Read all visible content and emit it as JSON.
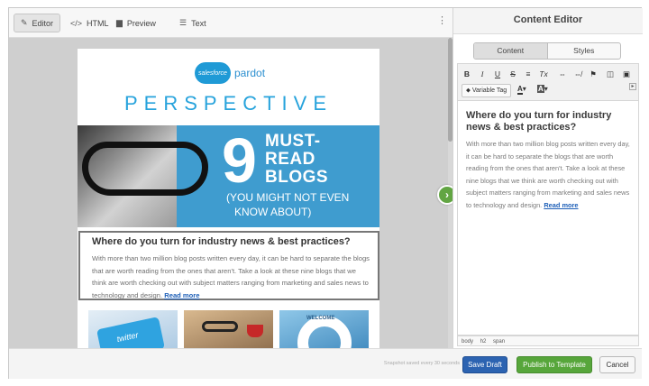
{
  "toolbar": {
    "tabs": [
      {
        "label": "Editor",
        "icon": "pencil-square-icon",
        "active": true
      },
      {
        "label": "HTML",
        "icon": "code-icon",
        "active": false
      },
      {
        "label": "Preview",
        "icon": "document-icon",
        "active": false
      },
      {
        "label": "Text",
        "icon": "lines-icon",
        "active": false
      }
    ],
    "more_icon": "⋮"
  },
  "email": {
    "logo_cloud": "salesforce",
    "logo_text": "pardot",
    "masthead": "PERSPECTIVE",
    "hero": {
      "number": "9",
      "line1": "MUST-",
      "line2": "READ",
      "line3": "BLOGS",
      "sub1": "(YOU MIGHT NOT EVEN",
      "sub2": "KNOW ABOUT)"
    },
    "block_title": "Where do you turn for industry news & best practices?",
    "block_text": "With more than two million blog posts written every day, it can be hard to separate the blogs that are worth reading from the ones that aren't. Take a look at these nine blogs that we think are worth checking out with subject matters ranging from marketing and sales news to technology and design.",
    "read_more": "Read more",
    "thumb_labels": {
      "twitter": "twitter",
      "welcome": "WELCOME"
    }
  },
  "panel": {
    "title": "Content Editor",
    "segments": {
      "content": "Content",
      "styles": "Styles"
    },
    "rte": {
      "bold": "B",
      "italic": "I",
      "underline": "U",
      "strike": "S",
      "align": "≡",
      "clear": "Tx",
      "link": "⇔",
      "unlink": "⇎",
      "flag": "⚑",
      "source": "◫",
      "image": "▣",
      "variable_tag": "Variable Tag",
      "font_color": "A",
      "bg_color": "A"
    },
    "editor_title": "Where do you turn for industry news & best practices?",
    "editor_text": "With more than two million blog posts written every day, it can be hard to separate the blogs that are worth reading from the ones that aren't. Take a look at these nine blogs that we think are worth checking out with subject matters ranging from marketing and sales news to technology and design.",
    "editor_link": "Read more",
    "path": [
      "body",
      "h2",
      "span"
    ]
  },
  "footer": {
    "snapshot": "Snapshot saved every 30 seconds",
    "save_draft": "Save Draft",
    "publish": "Publish to Template",
    "cancel": "Cancel"
  },
  "toggle_icon": "›",
  "colors": {
    "accent_blue": "#2c63b1",
    "publish_green": "#57a63b",
    "hero_blue": "#3f9ccf",
    "link_blue": "#1d5fb8"
  }
}
